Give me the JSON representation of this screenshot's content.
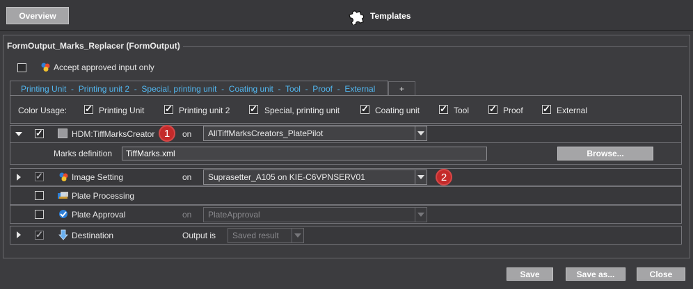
{
  "header": {
    "overview_label": "Overview",
    "title": "Templates"
  },
  "section": {
    "title": "FormOutput_Marks_Replacer (FormOutput)",
    "accept_label": "Accept approved input only"
  },
  "tabs": {
    "active_label": "Printing Unit  -  Printing unit 2  -  Special, printing unit  -  Coating unit  -  Tool  -  Proof  -  External",
    "add_label": "+"
  },
  "color_usage": {
    "label": "Color Usage:",
    "items": [
      "Printing Unit",
      "Printing unit 2",
      "Special, printing unit",
      "Coating unit",
      "Tool",
      "Proof",
      "External"
    ]
  },
  "rows": {
    "marks": {
      "name": "HDM:TiffMarksCreator",
      "on_label": "on",
      "select_value": "AllTiffMarksCreators_PlatePilot",
      "badge": "1"
    },
    "marks_def": {
      "label": "Marks definition",
      "value": "TiffMarks.xml",
      "browse_label": "Browse..."
    },
    "image_setting": {
      "name": "Image Setting",
      "on_label": "on",
      "select_value": "Suprasetter_A105 on KIE-C6VPNSERV01",
      "badge": "2"
    },
    "plate_processing": {
      "name": "Plate Processing"
    },
    "plate_approval": {
      "name": "Plate Approval",
      "on_label": "on",
      "select_value": "PlateApproval"
    },
    "destination": {
      "name": "Destination",
      "output_label": "Output is",
      "select_value": "Saved result"
    }
  },
  "footer": {
    "save_label": "Save",
    "save_as_label": "Save as...",
    "close_label": "Close"
  },
  "colors": {
    "accent_tab": "#52b7f0",
    "badge_red": "#c42a2a",
    "button_gray": "#a5a5a7",
    "background": "#3c3c3f"
  }
}
